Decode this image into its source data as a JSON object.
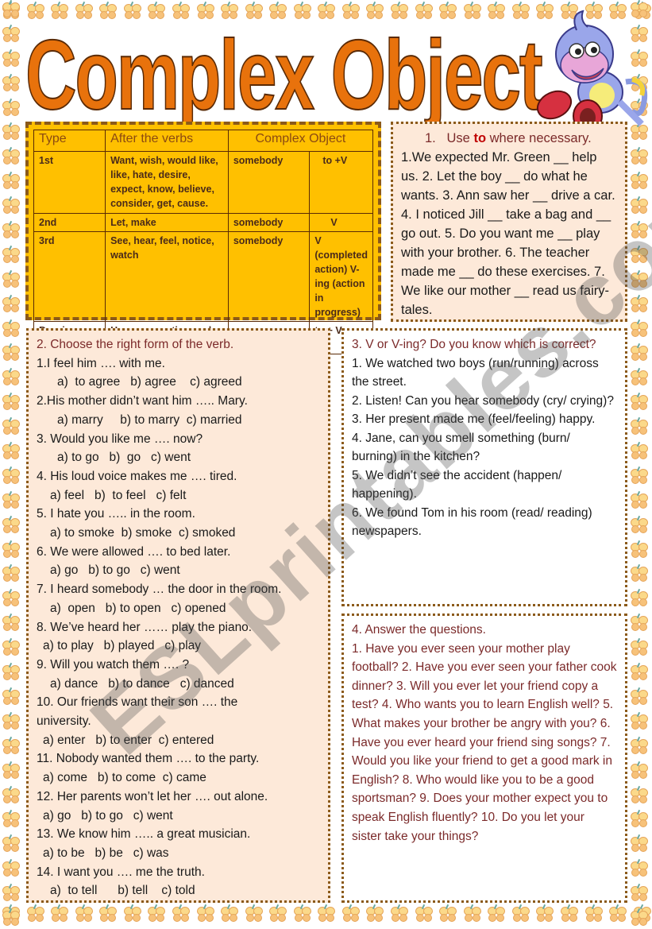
{
  "title": "Complex Object",
  "watermark": "ESLprintables.com",
  "colors": {
    "title_fill": "#e8720c",
    "table_bg": "#ffc000",
    "box_bg": "#fde9d9",
    "heading": "#7b2a2a",
    "accent": "#c00000"
  },
  "grammar_table": {
    "headers": [
      "Type",
      "After the verbs",
      "Complex Object"
    ],
    "rows": [
      {
        "type": "1st",
        "verbs": "Want, wish, would like, like, hate, desire, expect, know, believe, consider, get, cause.",
        "object": "somebody",
        "form": "to +V"
      },
      {
        "type": "2nd",
        "verbs": "Let, make",
        "object": "somebody",
        "form": "V"
      },
      {
        "type": "3rd",
        "verbs": "See, hear, feel, notice, watch",
        "object": "somebody",
        "form": "V (completed action) V-ing (action in progress)"
      },
      {
        "type": "Passive Voice",
        "verbs": "Hear, see, notice, make, allow",
        "object": "",
        "form": "to + V"
      }
    ]
  },
  "exercise1": {
    "heading_prefix": "1.   Use ",
    "heading_accent": "to",
    "heading_suffix": " where necessary.",
    "text": "1.We expected Mr. Green  __ help us.  2. Let the boy __ do what he wants.   3. Ann saw her __ drive a car.  4. I noticed Jill __ take a bag and __ go out.  5. Do you want me __ play with your brother.  6. The teacher made me __ do these exercises. 7. We like our mother __ read us fairy-tales."
  },
  "exercise2": {
    "heading": "2. Choose the right form of the verb.",
    "items": [
      {
        "q": "1.I feel him …. with me.",
        "opts": "a)  to agree   b) agree    c) agreed",
        "indent": 2
      },
      {
        "q": "2.His mother didn’t want him ….. Mary.",
        "opts": "a) marry     b) to marry  c) married",
        "indent": 2
      },
      {
        "q": "3. Would you like me …. now?",
        "opts": "a) to go   b)  go   c) went",
        "indent": 2
      },
      {
        "q": "4. His loud voice makes me …. tired.",
        "opts": "a) feel   b)  to feel   c) felt",
        "indent": 1
      },
      {
        "q": "5. I hate you ….. in the room.",
        "opts": "a) to smoke  b) smoke  c) smoked",
        "indent": 1
      },
      {
        "q": "6. We were allowed …. to bed later.",
        "opts": "a) go   b) to go   c) went",
        "indent": 1
      },
      {
        "q": "7. I heard somebody … the door in the room.",
        "opts": "a)  open   b) to open   c) opened",
        "indent": 1
      },
      {
        "q": "8. We’ve heard her …… play the piano.",
        "opts": "a) to play   b) played   c) play",
        "indent": 0
      },
      {
        "q": "9. Will you watch them …. ?",
        "opts": "a) dance   b) to dance   c) danced",
        "indent": 1
      },
      {
        "q": "10.  Our friends want their son …. the",
        "q2": "university.",
        "opts": "a) enter   b) to enter  c) entered",
        "indent": 0
      },
      {
        "q": "11. Nobody wanted them …. to the party.",
        "opts": "a) come   b) to come  c) came",
        "indent": 0
      },
      {
        "q": "12. Her parents won’t let her  ….  out alone.",
        "opts": "a) go   b) to go   c) went",
        "indent": 0
      },
      {
        "q": "13. We know him ….. a great musician.",
        "opts": "a) to be   b) be   c) was",
        "indent": 0
      },
      {
        "q": "14. I want you …. me the truth.",
        "opts": "a)  to tell      b) tell    c) told",
        "indent": 1
      }
    ]
  },
  "exercise3": {
    "heading": "3. V or V-ing? Do you know which is correct?",
    "items": [
      "1. We watched two boys (run/running) across the street.",
      "2. Listen! Can you hear somebody (cry/ crying)?",
      "3. Her present made me (feel/feeling) happy.",
      "4. Jane, can you smell something (burn/ burning) in the kitchen?",
      "5. We didn’t see the accident  (happen/  happening).",
      "6. We found Tom in his room (read/ reading) newspapers."
    ]
  },
  "exercise4": {
    "heading": "4. Answer the questions.",
    "text": "1. Have you ever seen your mother play football? 2. Have you ever seen your father cook dinner? 3.  Will you ever let your friend  copy a test?  4. Who wants you to learn English well?  5. What makes your brother be angry with you?  6. Have you ever heard your friend sing songs? 7. Would you like your friend to get a good mark in English?   8. Who would like you to be a good sportsman? 9. Does your mother expect you to speak English fluently? 10. Do you let your sister take your things?"
  }
}
